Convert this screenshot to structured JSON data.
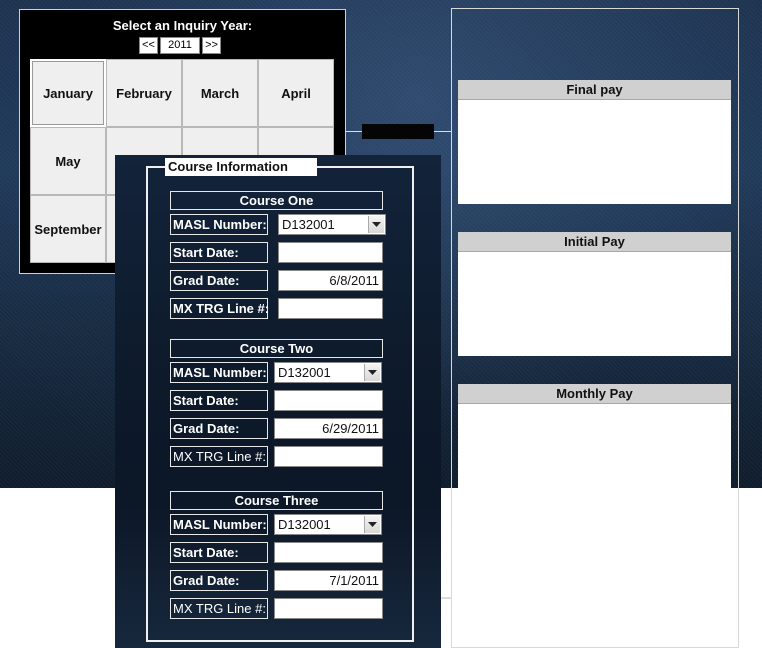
{
  "calendar": {
    "title": "Select an Inquiry Year:",
    "prev_label": "<<",
    "year": "2011",
    "next_label": ">>",
    "months": [
      "January",
      "February",
      "March",
      "April",
      "May",
      "",
      "",
      "",
      "September",
      "",
      "",
      ""
    ],
    "selected_month": "January"
  },
  "pay": {
    "final_title": "Final pay",
    "initial_title": "Initial Pay",
    "monthly_title": "Monthly Pay"
  },
  "course_info": {
    "legend": "Course Information",
    "courses": [
      {
        "title": "Course One",
        "masl_label": "MASL Number:",
        "masl_value": "D132001",
        "start_label": "Start Date:",
        "start_value": "",
        "grad_label": "Grad Date:",
        "grad_value": "6/8/2011",
        "mx_label": "MX TRG Line #:",
        "mx_value": ""
      },
      {
        "title": "Course Two",
        "masl_label": "MASL Number:",
        "masl_value": "D132001",
        "start_label": "Start Date:",
        "start_value": "",
        "grad_label": "Grad Date:",
        "grad_value": "6/29/2011",
        "mx_label": "MX TRG Line #:",
        "mx_value": ""
      },
      {
        "title": "Course Three",
        "masl_label": "MASL Number:",
        "masl_value": "D132001",
        "start_label": "Start Date:",
        "start_value": "",
        "grad_label": "Grad Date:",
        "grad_value": "7/1/2011",
        "mx_label": "MX TRG Line #:",
        "mx_value": ""
      }
    ]
  },
  "icons": {
    "dropdown": "chevron-down-icon"
  }
}
